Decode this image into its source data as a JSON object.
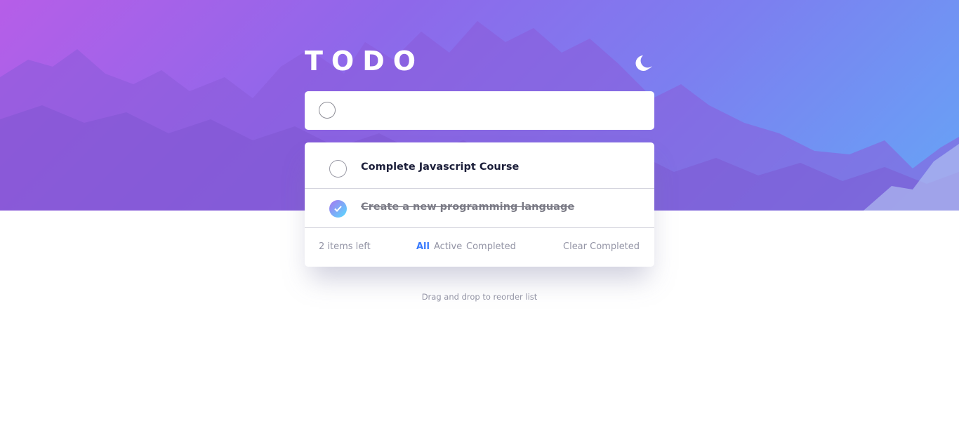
{
  "app": {
    "title": "TODO",
    "theme_icon": "moon-icon",
    "colors": {
      "accent": "#3a7bfd",
      "gradient_start": "#a675f0",
      "gradient_end": "#57ddff",
      "muted_text": "#9394a5",
      "dark_text": "#1c1f3a"
    }
  },
  "new_todo": {
    "value": "",
    "placeholder": ""
  },
  "todos": [
    {
      "label": "Complete Javascript Course",
      "completed": false
    },
    {
      "label": "Create a new programming language",
      "completed": true
    }
  ],
  "footer": {
    "items_left": "2 items left",
    "filters": {
      "all": "All",
      "active": "Active",
      "completed": "Completed",
      "selected": "All"
    },
    "clear_completed": "Clear Completed"
  },
  "hint": "Drag and drop to reorder list"
}
